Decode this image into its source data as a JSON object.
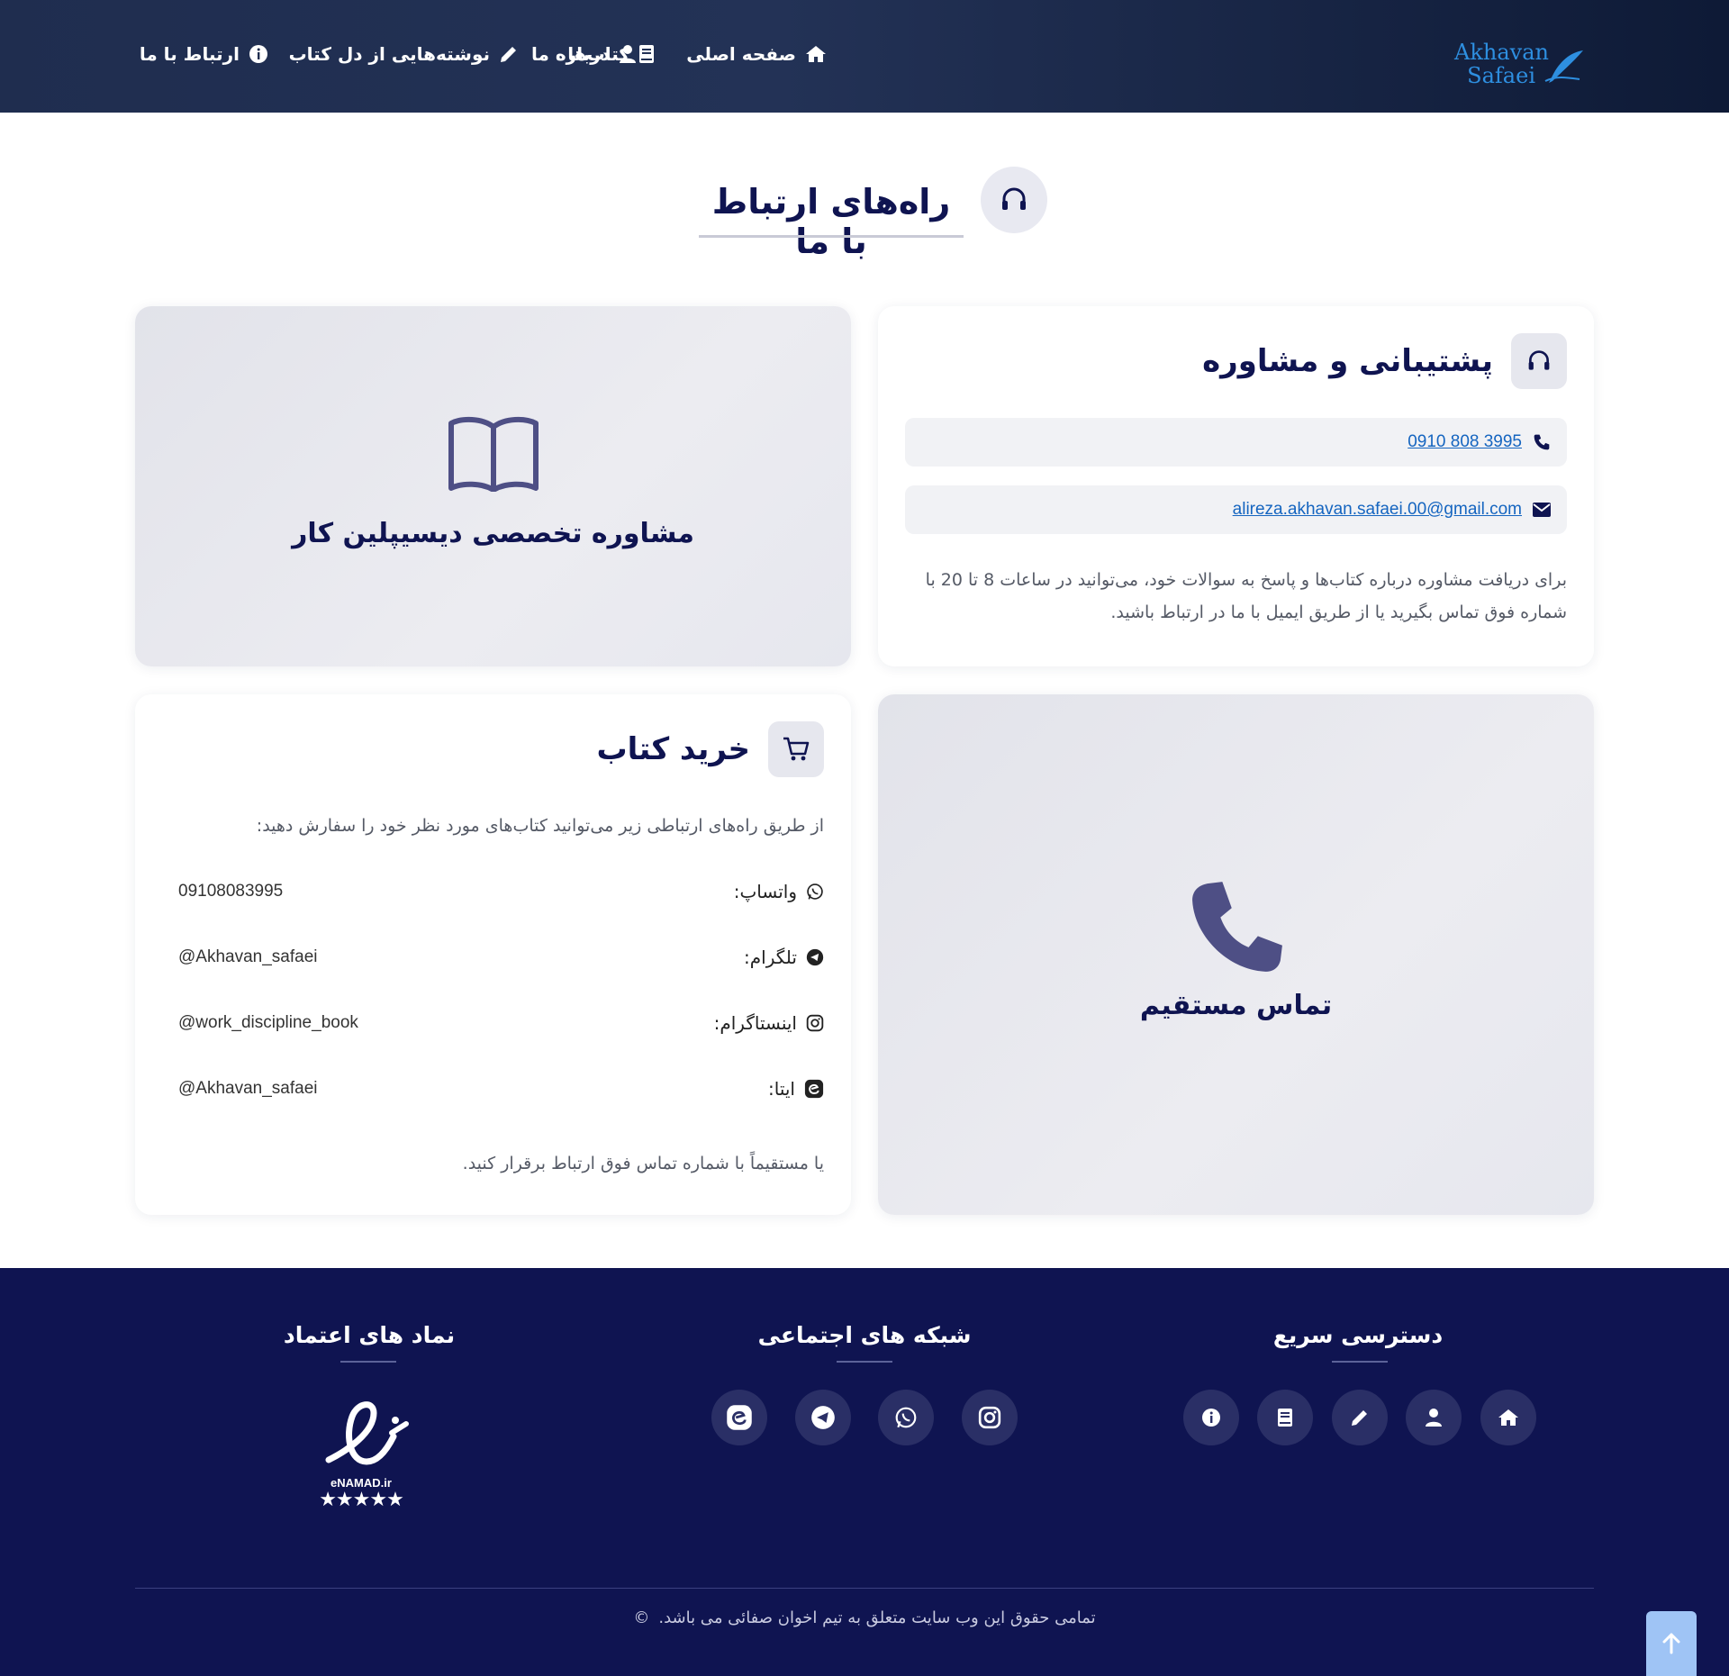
{
  "brand": {
    "line1": "Akhavan",
    "line2": "Safaei"
  },
  "nav": {
    "home": "صفحه اصلی",
    "about": "درباره ما",
    "books": "کتاب‌ها",
    "writings": "نوشته‌هایی از دل کتاب",
    "contact": "ارتباط با ما"
  },
  "page": {
    "title": "راه‌های ارتباط با ما"
  },
  "support": {
    "title": "پشتیبانی و مشاوره",
    "phone": "0910 808 3995",
    "email": "alireza.akhavan.safaei.00@gmail.com",
    "description": "برای دریافت مشاوره درباره کتاب‌ها و پاسخ به سوالات خود، می‌توانید در ساعات 8 تا 20 با شماره فوق تماس بگیرید یا از طریق ایمیل با ما در ارتباط باشید."
  },
  "consult_promo": {
    "text": "مشاوره تخصصی دیسیپلین کار"
  },
  "call_promo": {
    "text": "تماس مستقیم"
  },
  "purchase": {
    "title": "خرید کتاب",
    "intro": "از طریق راه‌های ارتباطی زیر می‌توانید کتاب‌های مورد نظر خود را سفارش دهید:",
    "channels": [
      {
        "label": "واتساپ:",
        "value": "09108083995",
        "icon": "whatsapp-icon"
      },
      {
        "label": "تلگرام:",
        "value": "@Akhavan_safaei",
        "icon": "telegram-icon"
      },
      {
        "label": "اینستاگرام:",
        "value": "@work_discipline_book",
        "icon": "instagram-icon"
      },
      {
        "label": "ایتا:",
        "value": "@Akhavan_safaei",
        "icon": "eitaa-icon"
      }
    ],
    "outro": "یا مستقیماً با شماره تماس فوق ارتباط برقرار کنید."
  },
  "footer": {
    "quick_access": "دسترسی سریع",
    "social": "شبکه های اجتماعی",
    "trust": "نماد های اعتماد",
    "enamad": "eNAMAD.ir",
    "copyright": "تمامی حقوق این وب سایت متعلق به تیم اخوان صفائی می باشد.",
    "copyright_symbol": "©"
  },
  "colors": {
    "navy": "#0f1451",
    "header": "#1f2d4f",
    "accent_icon": "#4e4f85",
    "link": "#1565c0"
  }
}
